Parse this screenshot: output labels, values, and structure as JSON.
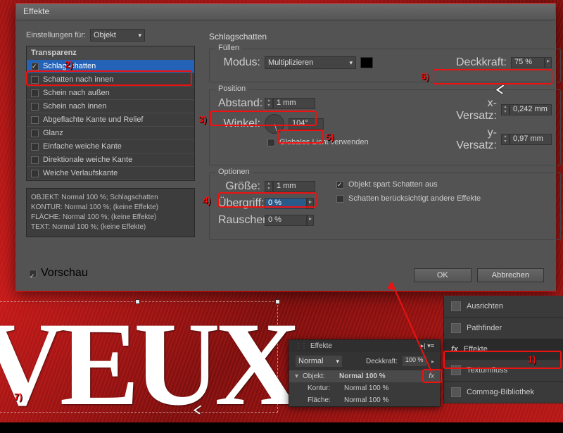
{
  "dialog": {
    "title": "Effekte",
    "settings_for_label": "Einstellungen für:",
    "settings_for_value": "Objekt",
    "section_title": "Schlagschatten",
    "effects_header": "Transparenz",
    "effects": [
      "Schlagschatten",
      "Schatten nach innen",
      "Schein nach außen",
      "Schein nach innen",
      "Abgeflachte Kante und Relief",
      "Glanz",
      "Einfache weiche Kante",
      "Direktionale weiche Kante",
      "Weiche Verlaufskante"
    ],
    "info": [
      "OBJEKT: Normal 100 %; Schlagschatten",
      "KONTUR: Normal 100 %; (keine Effekte)",
      "FLÄCHE: Normal 100 %; (keine Effekte)",
      "TEXT: Normal 100 %; (keine Effekte)"
    ],
    "fill": {
      "group": "Füllen",
      "modus_label": "Modus:",
      "modus_value": "Multiplizieren",
      "deckkraft_label": "Deckkraft:",
      "deckkraft_value": "75 %"
    },
    "position": {
      "group": "Position",
      "abstand_label": "Abstand:",
      "abstand_value": "1 mm",
      "winkel_label": "Winkel:",
      "winkel_value": "104°",
      "globales": "Globales Licht verwenden",
      "xversatz_label": "x-Versatz:",
      "xversatz_value": "0,242 mm",
      "yversatz_label": "y-Versatz:",
      "yversatz_value": "0,97 mm"
    },
    "options": {
      "group": "Optionen",
      "groesse_label": "Größe:",
      "groesse_value": "1 mm",
      "uebergriff_label": "Übergriff:",
      "uebergriff_value": "0 %",
      "rauschen_label": "Rauschen:",
      "rauschen_value": "0 %",
      "spart": "Objekt spart Schatten aus",
      "andere": "Schatten berücksichtigt andere Effekte"
    },
    "vorschau": "Vorschau",
    "ok": "OK",
    "cancel": "Abbrechen"
  },
  "panels": {
    "ausrichten": "Ausrichten",
    "pathfinder": "Pathfinder",
    "effekte": "Effekte",
    "textumfluss": "Textumfluss",
    "commag": "Commag-Bibliothek"
  },
  "fx_panel": {
    "tab": "Effekte",
    "mode": "Normal",
    "deck_label": "Deckkraft:",
    "deck_value": "100 %",
    "rows": [
      {
        "label": "Objekt:",
        "value": "Normal 100 %"
      },
      {
        "label": "Kontur:",
        "value": "Normal 100 %"
      },
      {
        "label": "Fläche:",
        "value": "Normal 100 %"
      }
    ]
  },
  "veux": "VEUX",
  "anno": {
    "n1": "1)",
    "n2": "2)",
    "n3": "3)",
    "n4": "4)",
    "n5": "5)",
    "n6": "6)",
    "n7": "7)"
  }
}
